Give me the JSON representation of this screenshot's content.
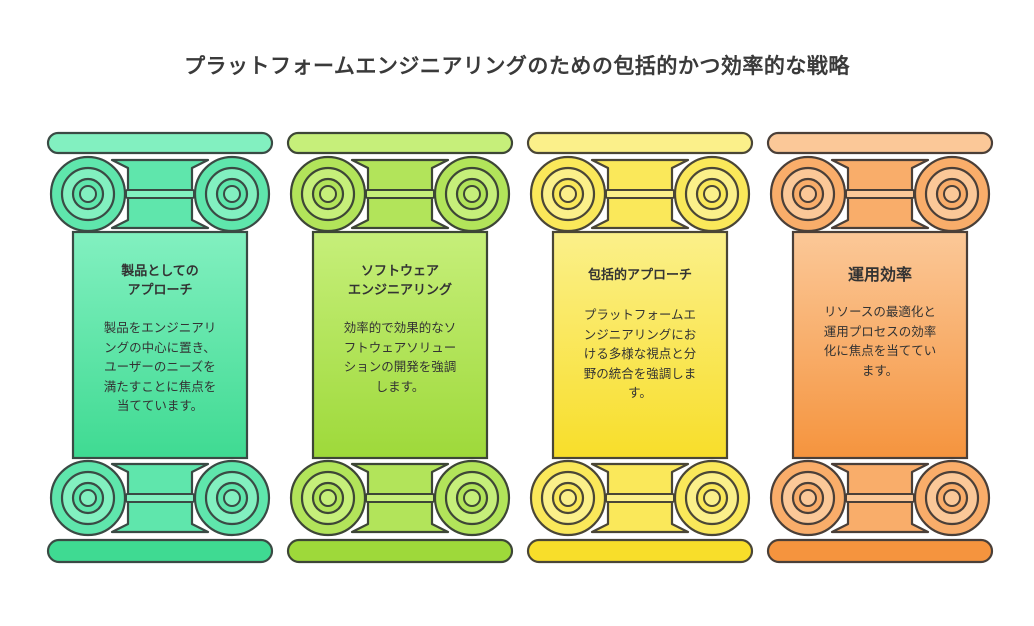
{
  "title": "プラットフォームエンジニアリングのための包括的かつ効率的な戦略",
  "pillars": [
    {
      "heading_lines": [
        "製品としての",
        "アプローチ"
      ],
      "body_lines": [
        "製品をエンジニアリ",
        "ングの中心に置き、",
        "ユーザーのニーズを",
        "満たすことに焦点を",
        "当てています。"
      ],
      "colors": {
        "light": "#82f0c0",
        "mid": "#5fe6ac",
        "dark": "#3fda92",
        "stroke": "#3a4a44"
      }
    },
    {
      "heading_lines": [
        "ソフトウェア",
        "エンジニアリング"
      ],
      "body_lines": [
        "効率的で効果的なソ",
        "フトウェアソリュー",
        "ションの開発を強調",
        "します。"
      ],
      "colors": {
        "light": "#c6ef7a",
        "mid": "#b2e45a",
        "dark": "#9ed93a",
        "stroke": "#3d4636"
      }
    },
    {
      "heading_lines": [
        "包括的アプローチ"
      ],
      "body_lines": [
        "プラットフォームエ",
        "ンジニアリングにお",
        "ける多様な視点と分",
        "野の統合を強調しま",
        "す。"
      ],
      "colors": {
        "light": "#fbf08a",
        "mid": "#fae85a",
        "dark": "#f8de2a",
        "stroke": "#4a4636"
      }
    },
    {
      "heading_lines": [
        "運用効率"
      ],
      "body_lines": [
        "リソースの最適化と",
        "運用プロセスの効率",
        "化に焦点を当ててい",
        "ます。"
      ],
      "colors": {
        "light": "#fbc898",
        "mid": "#f9ad6a",
        "dark": "#f5943e",
        "stroke": "#4a3f38"
      }
    }
  ]
}
